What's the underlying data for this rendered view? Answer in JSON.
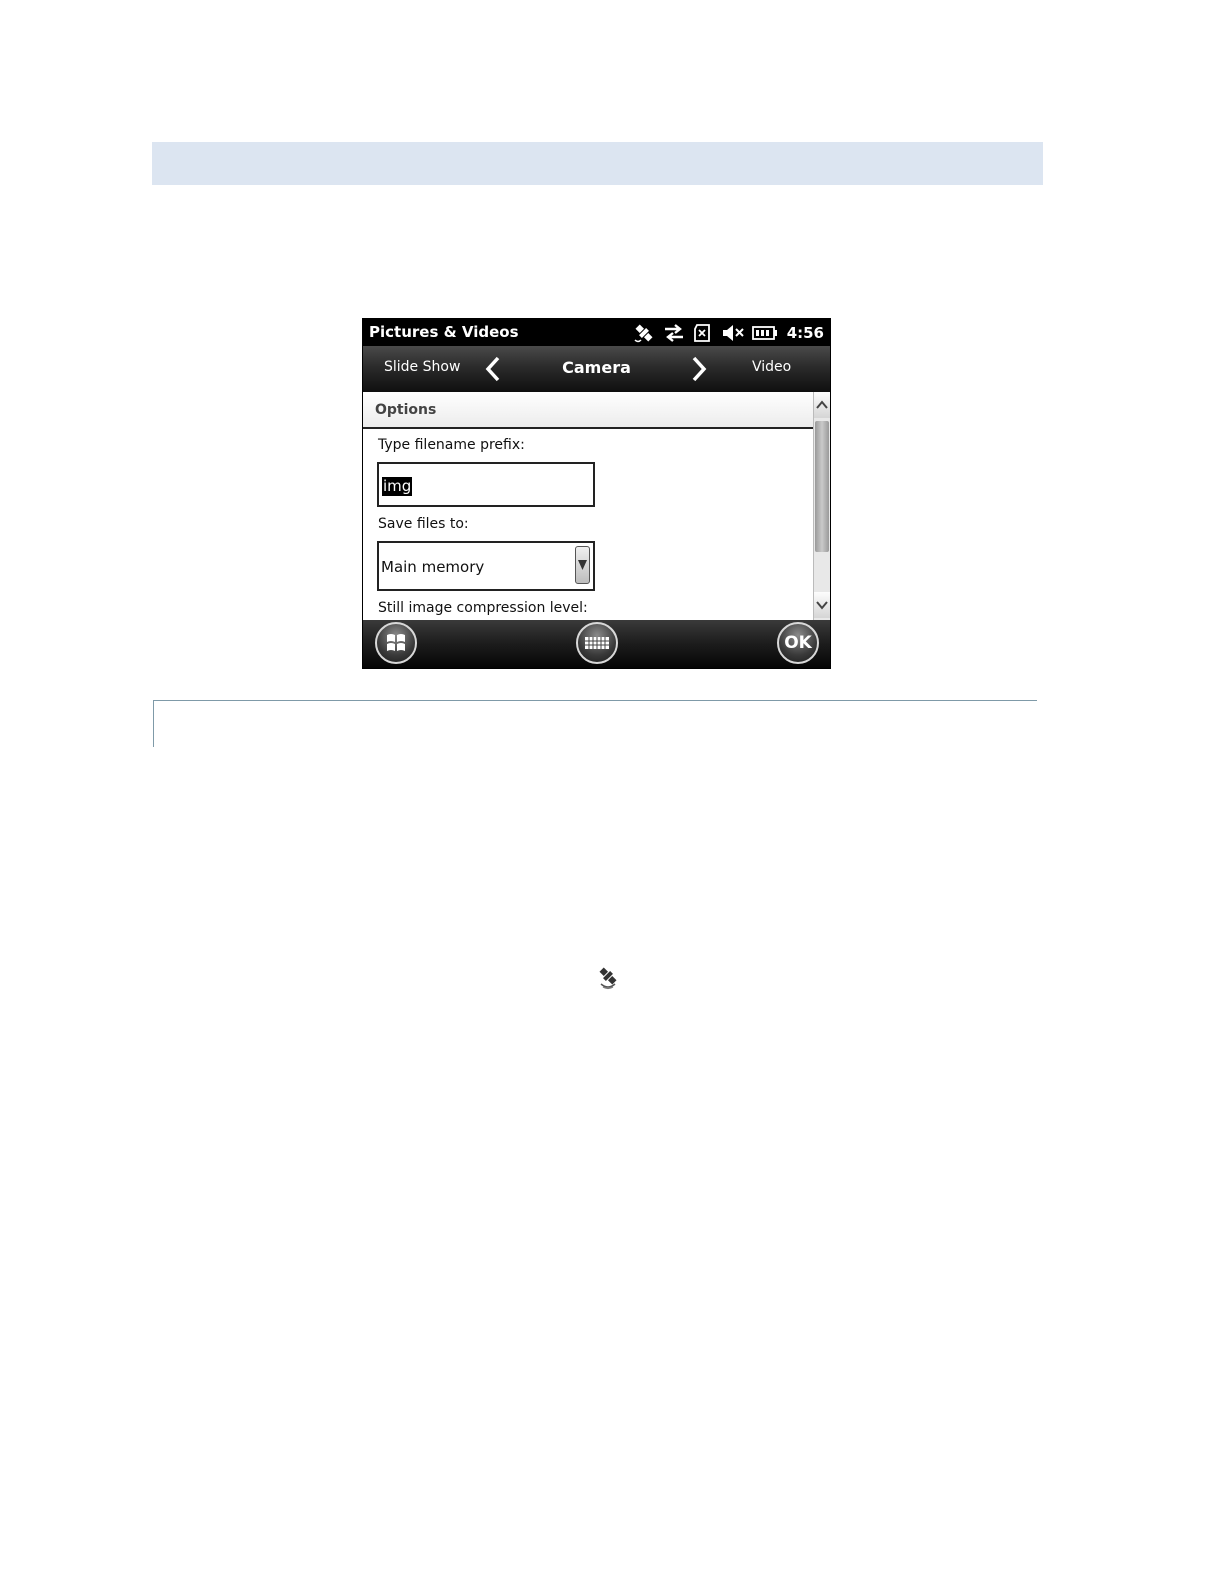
{
  "device": {
    "app_title": "Pictures & Videos",
    "clock": "4:56",
    "status_icons": [
      "gps-satellite-icon",
      "sync-arrows-icon",
      "no-sim-card-icon",
      "speaker-muted-icon",
      "battery-icon"
    ],
    "nav": {
      "prev_label": "Slide Show",
      "current_label": "Camera",
      "next_label": "Video"
    },
    "options_header": "Options",
    "fields": {
      "prefix_label": "Type filename prefix:",
      "prefix_value": "img",
      "save_label": "Save files to:",
      "save_value": "Main memory",
      "compression_label": "Still image compression level:"
    },
    "softkeys": {
      "start_icon": "windows-start-icon",
      "keyboard_icon": "keyboard-icon",
      "ok_label": "OK"
    }
  },
  "page": {
    "inline_icon": "gps-satellite-icon"
  }
}
